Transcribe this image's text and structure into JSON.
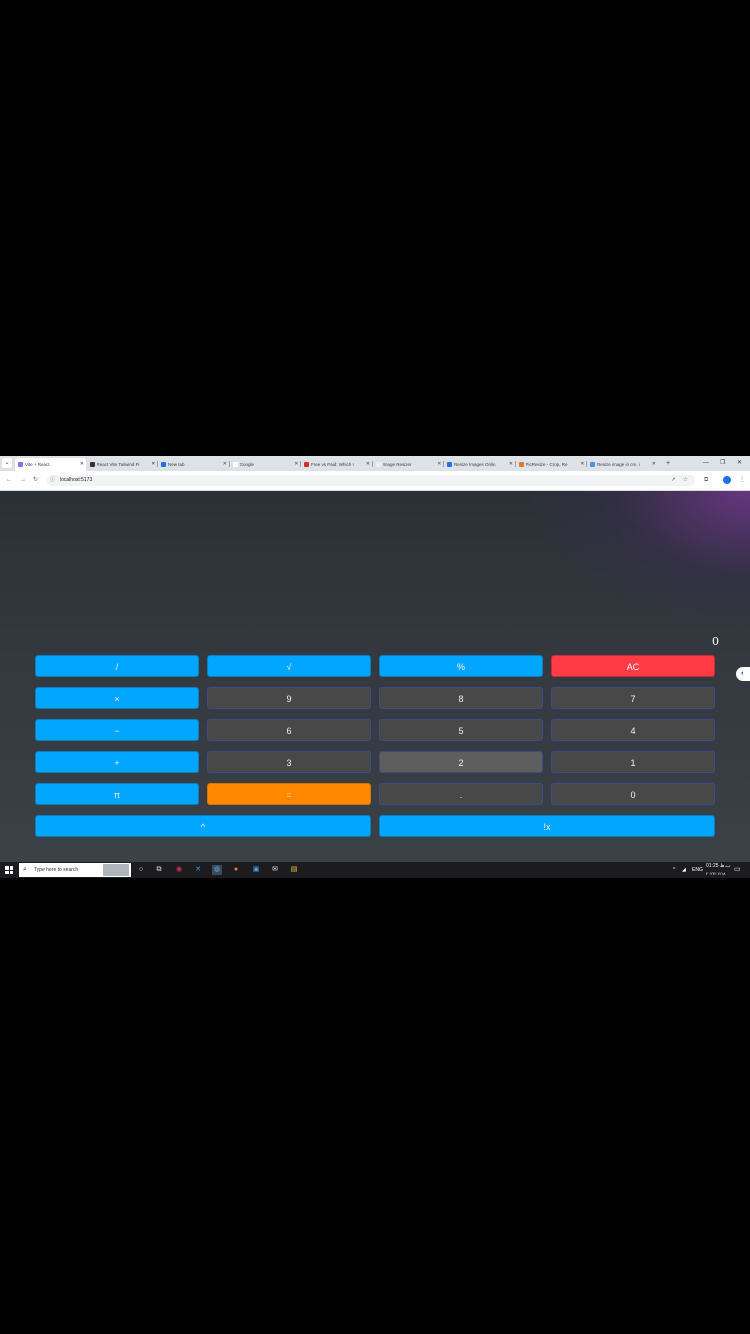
{
  "browser": {
    "tabs": [
      {
        "label": "Vite + React",
        "active": true,
        "fav_color": "#8c6cff"
      },
      {
        "label": "React Vite Tailwind Fi",
        "active": false,
        "fav_color": "#333333"
      },
      {
        "label": "New tab",
        "active": false,
        "fav_color": "#1a73e8"
      },
      {
        "label": "Google",
        "active": false,
        "fav_color": "#ffffff"
      },
      {
        "label": "Free vs Paid: Which I",
        "active": false,
        "fav_color": "#d93025"
      },
      {
        "label": "Image Resizer",
        "active": false,
        "fav_color": "#e8f0fe"
      },
      {
        "label": "Resize Images Onlin",
        "active": false,
        "fav_color": "#1a73e8"
      },
      {
        "label": "PicResize - Crop, Re",
        "active": false,
        "fav_color": "#e07a2a"
      },
      {
        "label": "Resize image in cm, i",
        "active": false,
        "fav_color": "#4a8fe0"
      }
    ],
    "url": "localhost:5173"
  },
  "calculator": {
    "display": "0",
    "keys": [
      {
        "label": "/",
        "kind": "op"
      },
      {
        "label": "√",
        "kind": "op"
      },
      {
        "label": "%",
        "kind": "op"
      },
      {
        "label": "AC",
        "kind": "ac"
      },
      {
        "label": "×",
        "kind": "op"
      },
      {
        "label": "9",
        "kind": "num"
      },
      {
        "label": "8",
        "kind": "num"
      },
      {
        "label": "7",
        "kind": "num"
      },
      {
        "label": "−",
        "kind": "op"
      },
      {
        "label": "6",
        "kind": "num"
      },
      {
        "label": "5",
        "kind": "num"
      },
      {
        "label": "4",
        "kind": "num"
      },
      {
        "label": "+",
        "kind": "op"
      },
      {
        "label": "3",
        "kind": "num"
      },
      {
        "label": "2",
        "kind": "num-hi"
      },
      {
        "label": "1",
        "kind": "num"
      },
      {
        "label": "π",
        "kind": "op"
      },
      {
        "label": "=",
        "kind": "eq"
      },
      {
        "label": ".",
        "kind": "num"
      },
      {
        "label": "0",
        "kind": "num"
      },
      {
        "label": "^",
        "kind": "op"
      },
      {
        "label": "!x",
        "kind": "op"
      }
    ]
  },
  "taskbar": {
    "search_placeholder": "Type here to search",
    "language": "ENG",
    "time": "01:25 ب.ظ",
    "date": "۲۰۲۳/۰۶/۱۸"
  }
}
